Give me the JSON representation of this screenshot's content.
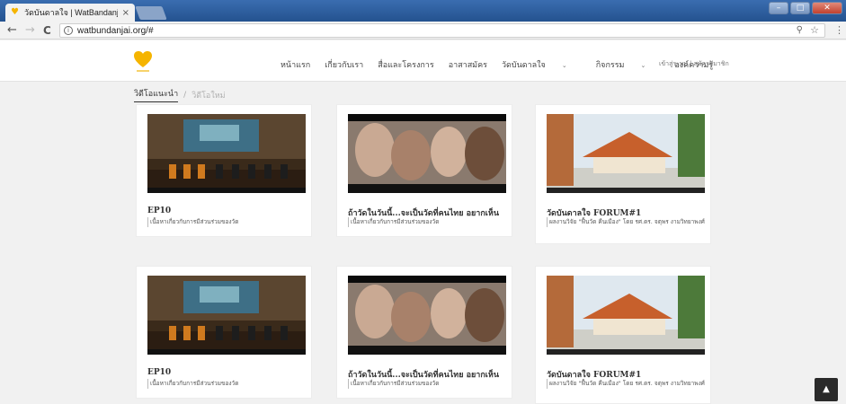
{
  "browser": {
    "tab_title": "วัดบันดาลใจ | WatBandanjai",
    "tab_close": "×",
    "back": "←",
    "forward": "→",
    "reload": "C",
    "info": "i",
    "url": "watbundanjai.org/#",
    "zoom_icon": "zoom-icon",
    "star_icon": "star-icon"
  },
  "nav": {
    "items": [
      "หน้าแรก",
      "เกี่ยวกับเรา",
      "สื่อและโครงการ",
      "อาสาสมัคร",
      "วัดบันดาลใจ",
      "กิจกรรม",
      "องค์ความรู้"
    ],
    "login": "เข้าสู่ระบบ | สมัครสมาชิก"
  },
  "crumb": {
    "active": "วิดีโอแนะนำ",
    "inactive": "วิดีโอใหม่"
  },
  "cards": [
    {
      "title": "EP10",
      "desc": "เนื้อหาเกี่ยวกับการมีส่วนร่วมของวัด"
    },
    {
      "title": "ถ้าวัดในวันนี้...จะเป็นวัดที่คนไทย อยากเห็น",
      "desc": "เนื้อหาเกี่ยวกับการมีส่วนร่วมของวัด"
    },
    {
      "title": "วัดบันดาลใจ FORUM#1",
      "desc": "ผลงานวิจัย \"ฟื้นวัด คืนเมือง\" โดย รศ.ดร. จตุพร งามวิทยาพงศ์"
    },
    {
      "title": "EP10",
      "desc": "เนื้อหาเกี่ยวกับการมีส่วนร่วมของวัด"
    },
    {
      "title": "ถ้าวัดในวันนี้...จะเป็นวัดที่คนไทย อยากเห็น",
      "desc": "เนื้อหาเกี่ยวกับการมีส่วนร่วมของวัด"
    },
    {
      "title": "วัดบันดาลใจ FORUM#1",
      "desc": "ผลงานวิจัย \"ฟื้นวัด คืนเมือง\" โดย รศ.ดร. จตุพร งามวิทยาพงศ์"
    }
  ],
  "colors": {
    "accent": "#f5b400",
    "chrome": "#24528f",
    "scrolltop": "#2a2a2a"
  },
  "scrolltop_icon": "arrow-up-icon"
}
